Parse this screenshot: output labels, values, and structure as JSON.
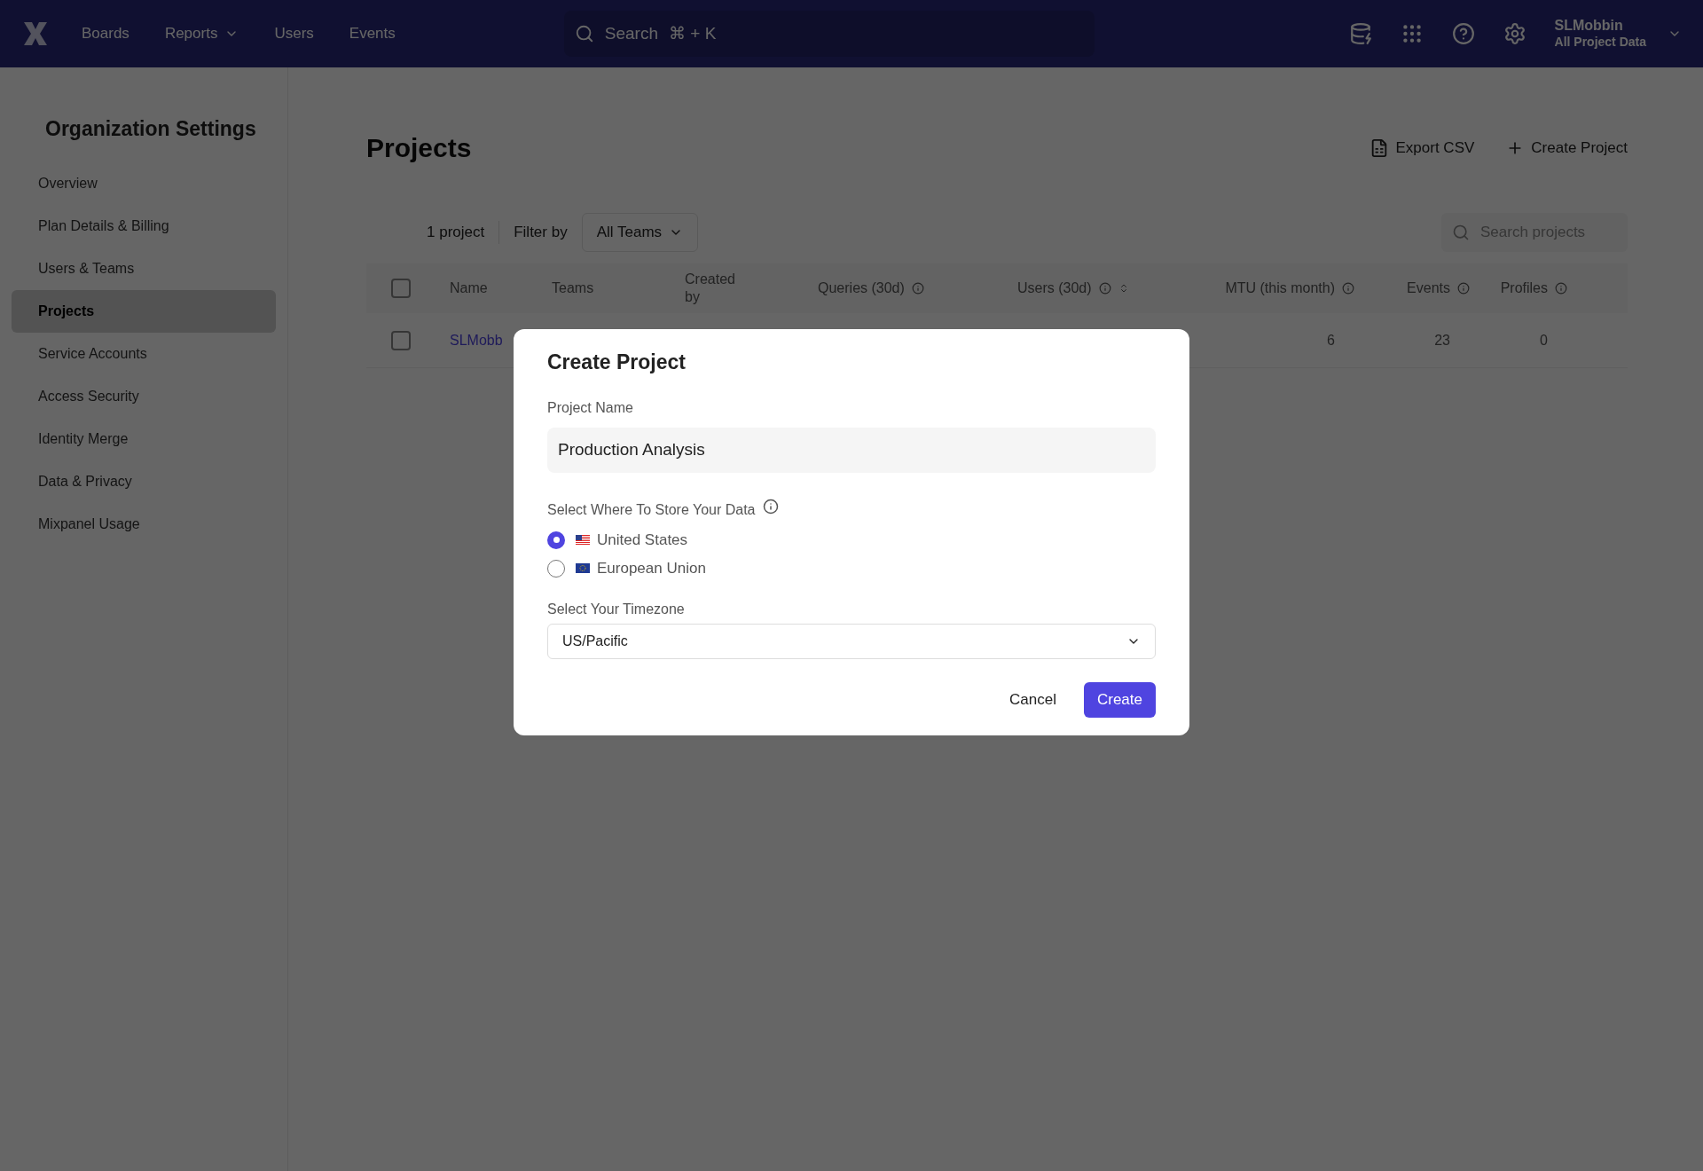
{
  "nav": {
    "items": [
      {
        "label": "Boards",
        "dropdown": false
      },
      {
        "label": "Reports",
        "dropdown": true
      },
      {
        "label": "Users",
        "dropdown": false
      },
      {
        "label": "Events",
        "dropdown": false
      }
    ],
    "search": {
      "placeholder": "Search",
      "shortcut": "⌘ + K"
    },
    "account": {
      "name": "SLMobbin",
      "project": "All Project Data"
    }
  },
  "sidebar": {
    "title": "Organization Settings",
    "items": [
      {
        "label": "Overview",
        "selected": false
      },
      {
        "label": "Plan Details & Billing",
        "selected": false
      },
      {
        "label": "Users & Teams",
        "selected": false
      },
      {
        "label": "Projects",
        "selected": true
      },
      {
        "label": "Service Accounts",
        "selected": false
      },
      {
        "label": "Access Security",
        "selected": false
      },
      {
        "label": "Identity Merge",
        "selected": false
      },
      {
        "label": "Data & Privacy",
        "selected": false
      },
      {
        "label": "Mixpanel Usage",
        "selected": false
      }
    ]
  },
  "page": {
    "title": "Projects",
    "actions": [
      "Export CSV",
      "Create Project"
    ],
    "count": "1 project",
    "filter_label": "Filter by",
    "filter_value": "All Teams",
    "search_placeholder": "Search projects"
  },
  "table": {
    "columns": [
      {
        "label": "Name",
        "info": false,
        "sort": false
      },
      {
        "label": "Teams",
        "info": false,
        "sort": false
      },
      {
        "label": "Created by",
        "info": false,
        "sort": false
      },
      {
        "label": "Queries (30d)",
        "info": true,
        "sort": false
      },
      {
        "label": "Users (30d)",
        "info": true,
        "sort": true
      },
      {
        "label": "MTU (this month)",
        "info": true,
        "sort": false
      },
      {
        "label": "Events",
        "info": true,
        "sort": false
      },
      {
        "label": "Profiles",
        "info": true,
        "sort": false
      }
    ],
    "select_all": {
      "checked": false
    },
    "rows": [
      {
        "checked": false,
        "cells": [
          "SLMobb",
          "",
          "",
          "",
          "",
          "6",
          "23",
          "0"
        ]
      }
    ]
  },
  "dialog": {
    "title": "Create Project",
    "name_label": "Project Name",
    "name_value": "Production Analysis",
    "region_label": "Select Where To Store Your Data",
    "regions": [
      {
        "label": "United States",
        "kind": "us",
        "selected": true
      },
      {
        "label": "European Union",
        "kind": "eu",
        "selected": false
      }
    ],
    "timezone_label": "Select Your Timezone",
    "timezone_value": "US/Pacific",
    "buttons": [
      {
        "label": "Cancel",
        "kind": "secondary"
      },
      {
        "label": "Create",
        "kind": "primary"
      }
    ]
  }
}
